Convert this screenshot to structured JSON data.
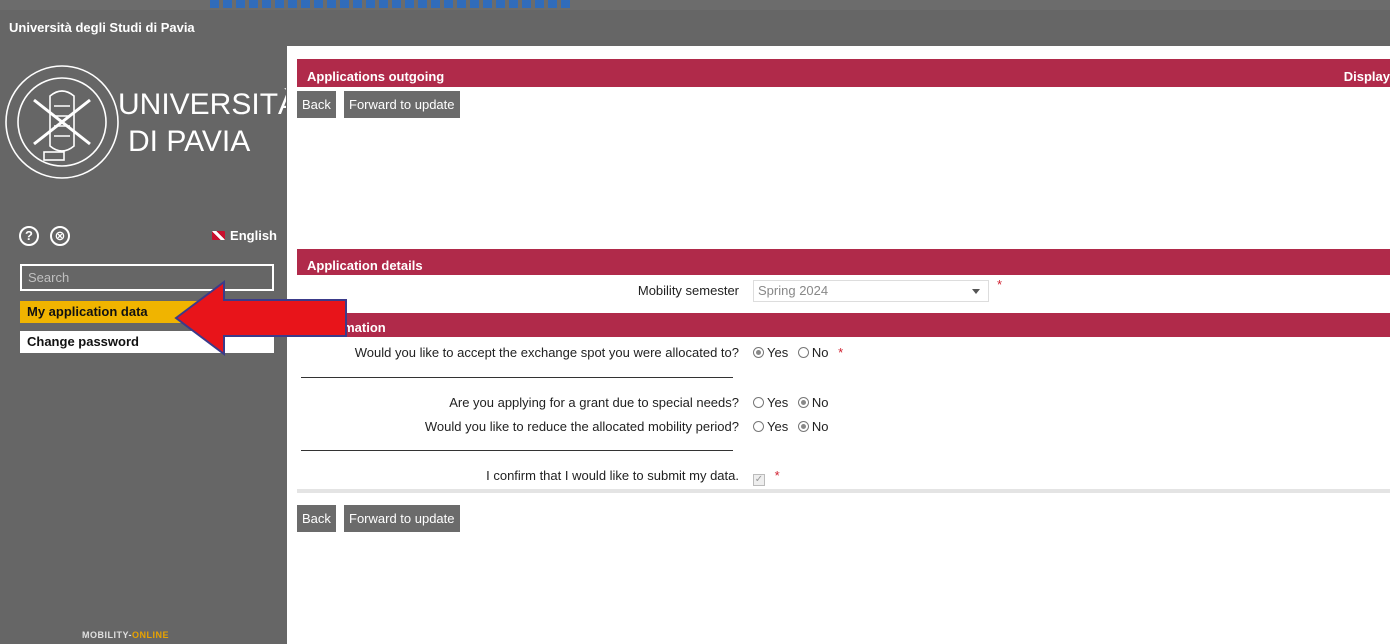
{
  "header": {
    "site_title": "Università degli Studi di Pavia"
  },
  "sidebar": {
    "logo_text_line1": "UNIVERSITÀ",
    "logo_text_line2": "DI PAVIA",
    "help_icon": "?",
    "close_icon": "⊗",
    "language": "English",
    "search_placeholder": "Search",
    "nav": [
      {
        "label": "My application data",
        "active": true
      },
      {
        "label": "Change password",
        "active": false
      }
    ],
    "footer_logo_a": "MOBILITY-",
    "footer_logo_b": "ONLINE"
  },
  "main": {
    "title_bar": {
      "title": "Applications outgoing",
      "right": "Display"
    },
    "buttons": {
      "back": "Back",
      "forward": "Forward to update"
    },
    "section_details": "Application details",
    "mobility_semester": {
      "label": "Mobility semester",
      "value": "Spring 2024",
      "required": "*"
    },
    "section_general": "l information",
    "q_accept": {
      "label": "Would you like to accept the exchange spot you were allocated to?",
      "yes": "Yes",
      "no": "No",
      "selected": "yes",
      "required": "*"
    },
    "q_special": {
      "label": "Are you applying for a grant due to special needs?",
      "yes": "Yes",
      "no": "No",
      "selected": "no"
    },
    "q_reduce": {
      "label": "Would you like to reduce the allocated mobility period?",
      "yes": "Yes",
      "no": "No",
      "selected": "no"
    },
    "confirm": {
      "label": "I confirm that I would like to submit my data.",
      "required": "*",
      "checked": true
    }
  },
  "colors": {
    "accent_bar": "#b02a4a",
    "nav_active": "#f0b400",
    "sidebar": "#666666",
    "arrow": "#e8141a"
  }
}
